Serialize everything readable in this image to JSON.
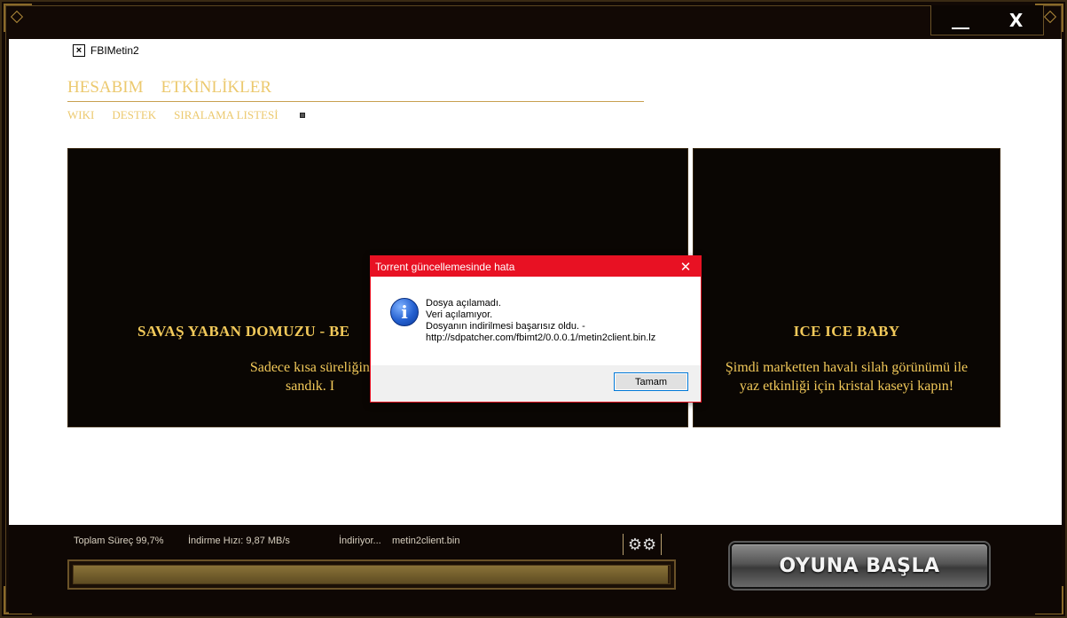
{
  "window": {
    "app_title": "FBIMetin2",
    "minimize_label": "__",
    "close_label": "X"
  },
  "nav": {
    "main": [
      "HESABIM",
      "ETKİNLİKLER"
    ],
    "sub": [
      "WIKI",
      "DESTEK",
      "SIRALAMA LISTESİ"
    ]
  },
  "banners": {
    "left": {
      "title": "SAVAŞ YABAN DOMUZU - BE",
      "desc_line1": "Sadece kısa süreliğine nesne markette: Popül",
      "desc_line2": "sandık. I"
    },
    "right": {
      "title": "ICE ICE BABY",
      "desc_line1": "Şimdi marketten havalı silah görünümü ile",
      "desc_line2": "yaz etkinliği için kristal kaseyi kapın!"
    }
  },
  "dialog": {
    "title": "Torrent güncellemesinde hata",
    "close_label": "✕",
    "icon": "info-icon",
    "icon_glyph": "i",
    "lines": [
      "Dosya açılamadı.",
      "Veri açılamıyor.",
      "Dosyanın indirilmesi başarısız oldu. -",
      "http://sdpatcher.com/fbimt2/0.0.0.1/metin2client.bin.lz"
    ],
    "ok_label": "Tamam"
  },
  "status": {
    "total_progress": "Toplam Süreç 99,7%",
    "download_speed": "İndirme Hızı: 9,87 MB/s",
    "downloading_label": "İndiriyor...",
    "downloading_file": "metin2client.bin",
    "progress_fraction": 0.997
  },
  "play_button": {
    "label": "OYUNA BAŞLA"
  },
  "colors": {
    "accent_gold": "#ecc96e",
    "dialog_red": "#e81123",
    "frame_dark": "#120905"
  }
}
